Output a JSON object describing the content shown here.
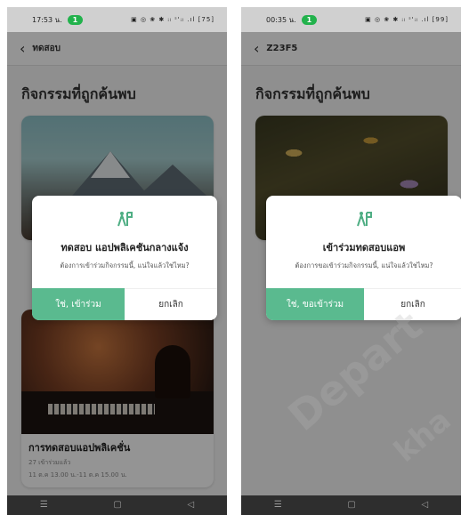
{
  "left": {
    "status": {
      "time": "17:53 น.",
      "badge": "1",
      "icons": "▣ ◎ ❀ ✱ ᵢₗ ˢ'ᵢₗ .ıl [75]"
    },
    "header": {
      "title": "ทดสอบ"
    },
    "section_title": "กิจกรรมที่ถูกค้นพบ",
    "cards": [
      {
        "title": "การทดสอบแอปพลิเคชั่น",
        "meta_count": "27 เข้าร่วมแล้ว",
        "meta_time": "11 ต.ค 13.00 น.-11 ต.ค 15.00 น."
      }
    ],
    "dialog": {
      "title": "ทดสอบ แอปพลิเคชันกลางแจ้ง",
      "message": "ต้องการเข้าร่วมกิจกรรมนี้, แน่ใจแล้วใช่ไหม?",
      "confirm": "ใช่, เข้าร่วม",
      "cancel": "ยกเลิก"
    }
  },
  "right": {
    "status": {
      "time": "00:35 น.",
      "badge": "1",
      "icons": "▣ ◎ ❀ ✱ ᵢₗ ˢ'ᵢₗ .ıl [99]"
    },
    "header": {
      "title": "Z23F5"
    },
    "section_title": "กิจกรรมที่ถูกค้นพบ",
    "dialog": {
      "title": "เข้าร่วมทดสอบแอพ",
      "message": "ต้องการขอเข้าร่วมกิจกรรมนี้, แน่ใจแล้วใช่ไหม?",
      "confirm": "ใช่, ขอเข้าร่วม",
      "cancel": "ยกเลิก"
    }
  },
  "nav_icons": [
    "☰",
    "▢",
    "◁"
  ],
  "watermark": "Depart",
  "watermark2": "kha",
  "colors": {
    "accent": "#5aba8f",
    "overlay": "rgba(0,0,0,0.42)"
  }
}
